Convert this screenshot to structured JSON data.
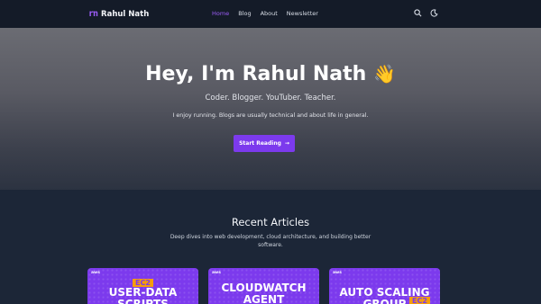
{
  "brand": {
    "mark": "rn",
    "name": "Rahul Nath"
  },
  "nav": {
    "items": [
      {
        "label": "Home",
        "active": true
      },
      {
        "label": "Blog",
        "active": false
      },
      {
        "label": "About",
        "active": false
      },
      {
        "label": "Newsletter",
        "active": false
      }
    ],
    "icons": [
      "search-icon",
      "moon-icon"
    ]
  },
  "hero": {
    "title": "Hey, I'm Rahul Nath",
    "emoji": "👋",
    "subtitle": "Coder. Blogger. YouTuber. Teacher.",
    "description": "I enjoy running. Blogs are usually technical and about life in general.",
    "cta_label": "Start Reading",
    "cta_arrow": "→"
  },
  "recent": {
    "title": "Recent Articles",
    "description": "Deep dives into web development, cloud architecture, and building better software."
  },
  "cards": [
    {
      "aws": "aws",
      "badge": "EC2",
      "title": "USER-DATA\nSCRIPTS"
    },
    {
      "aws": "aws",
      "badge": "",
      "title": "CLOUDWATCH\nAGENT"
    },
    {
      "aws": "aws",
      "badge": "EC2",
      "title": "AUTO SCALING\nGROUP"
    }
  ],
  "colors": {
    "accent": "#7c3aed",
    "nav_bg": "#141b28",
    "page_bg": "#1c2637",
    "badge": "#f59e0b"
  }
}
